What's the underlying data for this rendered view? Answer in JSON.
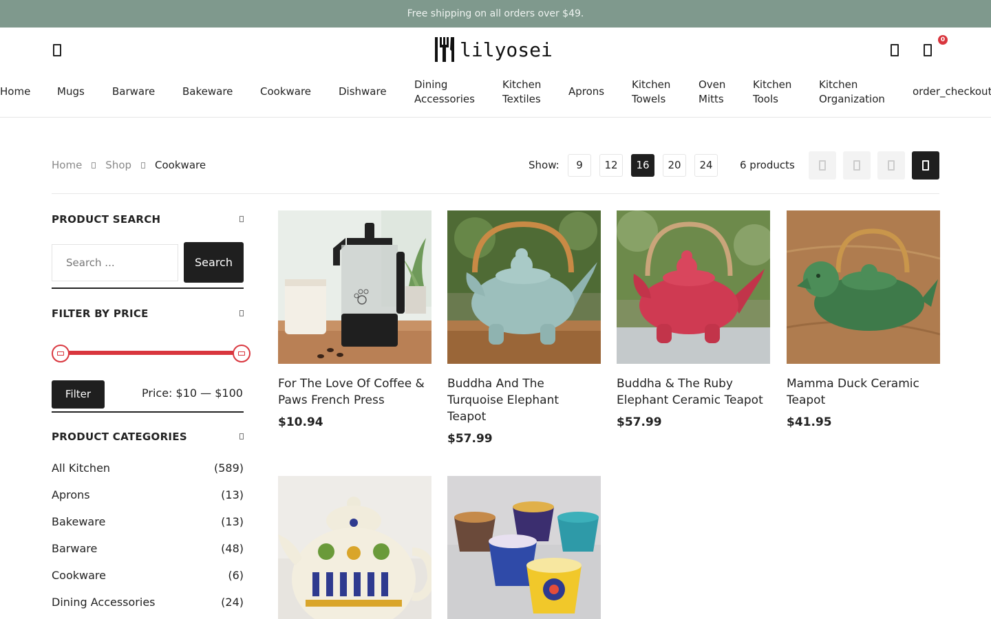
{
  "announcement": "Free shipping on all orders over $49.",
  "brand": {
    "name": "lilyosei"
  },
  "header": {
    "menu_icon": "menu-icon",
    "account_icon": "user-icon",
    "cart_icon": "cart-icon",
    "cart_count": "0"
  },
  "nav": [
    {
      "lines": [
        "Home"
      ]
    },
    {
      "lines": [
        "Mugs"
      ]
    },
    {
      "lines": [
        "Barware"
      ]
    },
    {
      "lines": [
        "Bakeware"
      ]
    },
    {
      "lines": [
        "Cookware"
      ]
    },
    {
      "lines": [
        "Dishware"
      ]
    },
    {
      "lines": [
        "Dining",
        "Accessories"
      ]
    },
    {
      "lines": [
        "Kitchen",
        "Textiles"
      ]
    },
    {
      "lines": [
        "Aprons"
      ]
    },
    {
      "lines": [
        "Kitchen",
        "Towels"
      ]
    },
    {
      "lines": [
        "Oven",
        "Mitts"
      ]
    },
    {
      "lines": [
        "Kitchen",
        "Tools"
      ]
    },
    {
      "lines": [
        "Kitchen",
        "Organization"
      ]
    },
    {
      "lines": [
        "order_checkout"
      ]
    }
  ],
  "breadcrumb": {
    "home": "Home",
    "shop": "Shop",
    "current": "Cookware"
  },
  "toolbar": {
    "show_label": "Show:",
    "per_page": [
      "9",
      "12",
      "16",
      "20",
      "24"
    ],
    "active_per_page": "16",
    "product_count": "6 products",
    "views": [
      "grid-2-icon",
      "grid-3-icon",
      "list-icon",
      "grid-4-icon"
    ],
    "active_view": "grid-4-icon"
  },
  "sidebar": {
    "search": {
      "title": "PRODUCT SEARCH",
      "placeholder": "Search ...",
      "button": "Search"
    },
    "price": {
      "title": "FILTER BY PRICE",
      "button": "Filter",
      "range_text": "Price: $10 — $100",
      "min": 10,
      "max": 100
    },
    "categories": {
      "title": "PRODUCT CATEGORIES",
      "items": [
        {
          "name": "All Kitchen",
          "count": "(589)"
        },
        {
          "name": "Aprons",
          "count": "(13)"
        },
        {
          "name": "Bakeware",
          "count": "(13)"
        },
        {
          "name": "Barware",
          "count": "(48)"
        },
        {
          "name": "Cookware",
          "count": "(6)"
        },
        {
          "name": "Dining Accessories",
          "count": "(24)"
        }
      ]
    }
  },
  "products": [
    {
      "title": "For The Love Of Coffee & Paws French Press",
      "price": "$10.94"
    },
    {
      "title": "Buddha And The Turquoise Elephant Teapot",
      "price": "$57.99"
    },
    {
      "title": "Buddha & The Ruby Elephant Ceramic Teapot",
      "price": "$57.99"
    },
    {
      "title": "Mamma Duck Ceramic Teapot",
      "price": "$41.95"
    },
    {
      "title": "",
      "price": ""
    },
    {
      "title": "",
      "price": ""
    }
  ],
  "colors": {
    "topbar": "#7f998d",
    "accent": "#d9363e",
    "dark": "#1f1f1f"
  }
}
